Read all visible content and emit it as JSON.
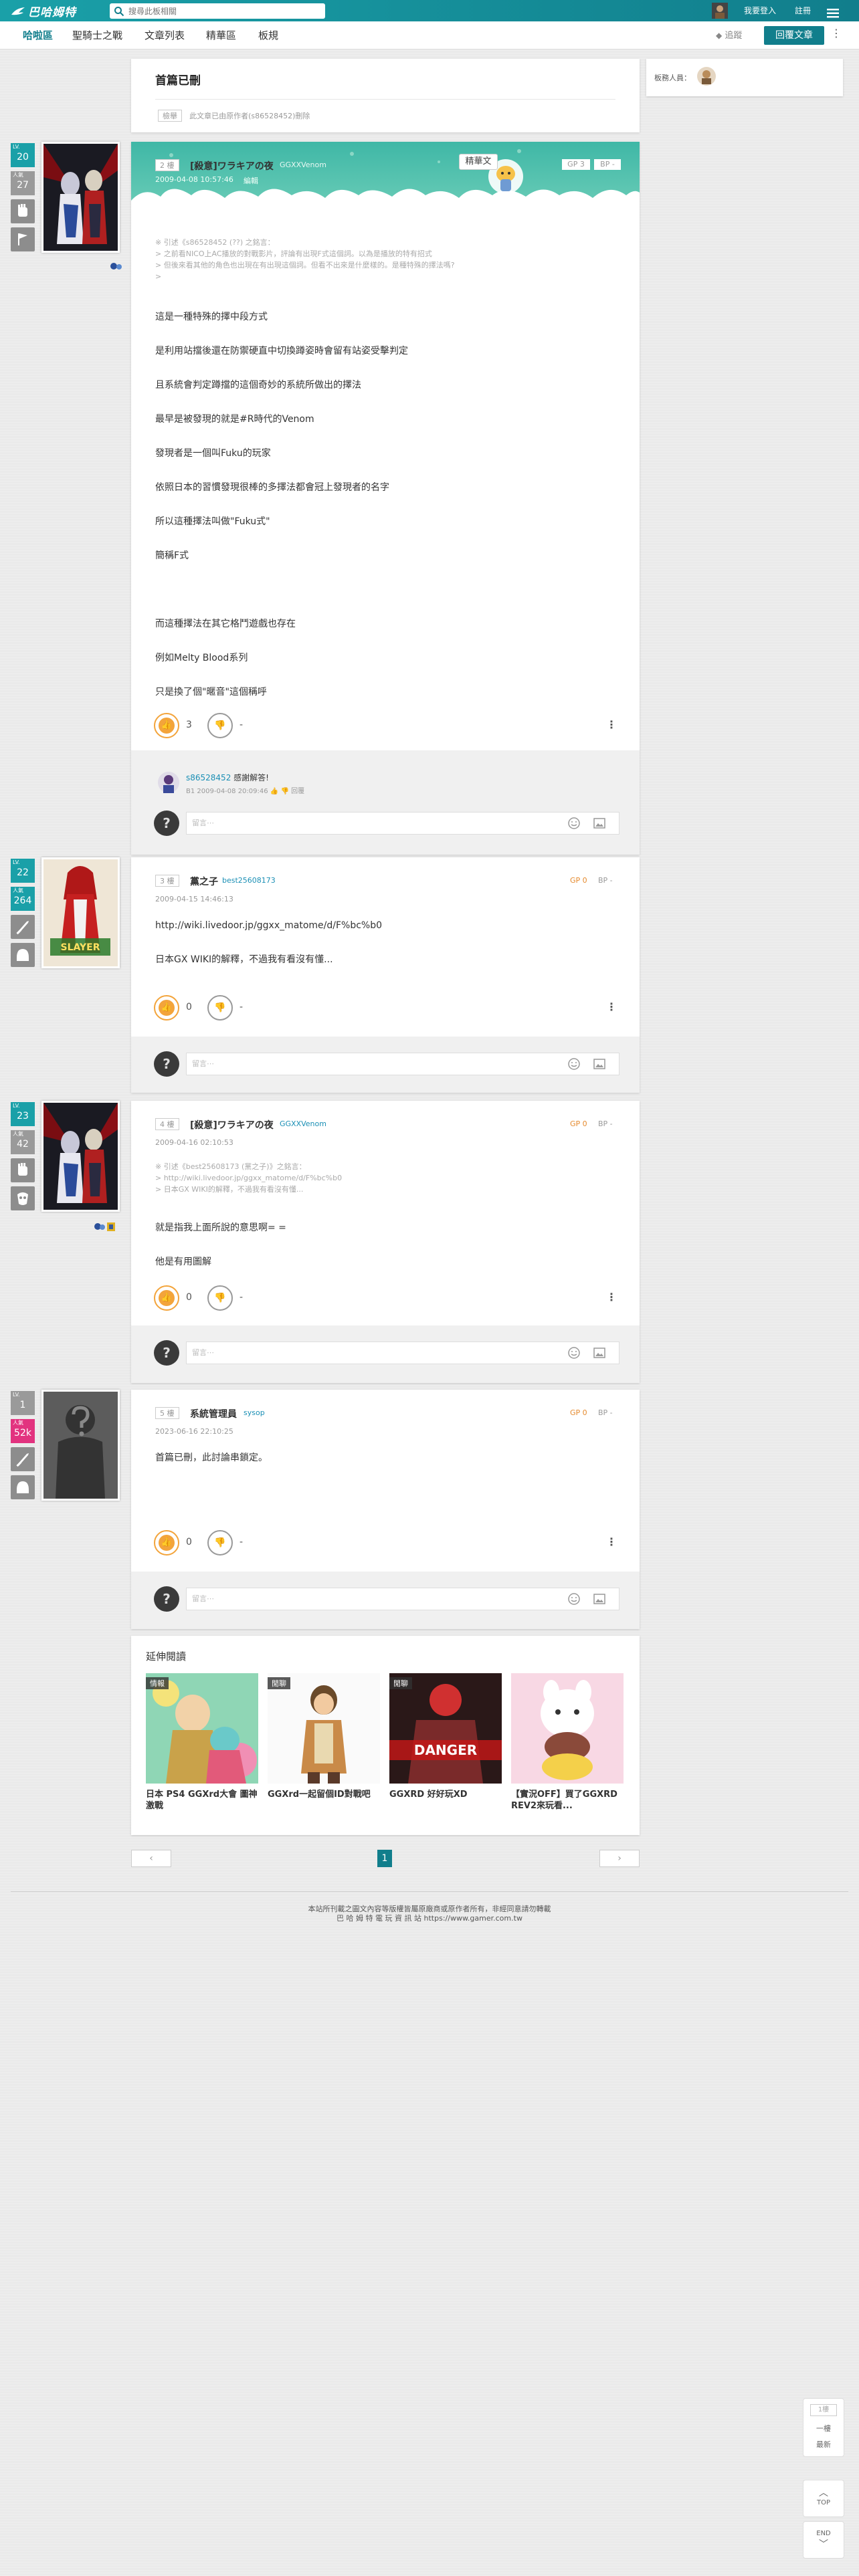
{
  "header": {
    "logo": "巴哈姆特",
    "search_placeholder": "搜尋此板相關",
    "login": "我要登入",
    "register": "註冊"
  },
  "nav": {
    "tabs": [
      "哈啦區",
      "聖騎士之戰",
      "文章列表",
      "精華區",
      "板規"
    ],
    "track": "追蹤",
    "reply": "回覆文章"
  },
  "sidebar": {
    "moderators": "板務人員："
  },
  "title_card": {
    "title": "首篇已刪",
    "tag": "檢舉",
    "note": "此文章已由原作者(s86528452)刪除"
  },
  "posts": [
    {
      "floor": "2 樓",
      "author": "[殺意]ワラキアの夜",
      "uid": "GGXXVenom",
      "time": "2009-04-08 10:57:46",
      "edit": "編輯",
      "gp": "GP 3",
      "bp": "BP -",
      "badge": "精華文",
      "quote": [
        "※ 引述《s86528452 (??) 之銘言：",
        "> 之前看NICO上AC播放的對戰影片，評論有出現F式這個詞。以為是播放的特有招式",
        "> 但後來看其他的角色也出現在有出現這個詞。但看不出來是什麼樣的。是種特殊的擇法嗎?",
        ">"
      ],
      "lines": [
        "這是一種特殊的擇中段方式",
        "是利用站擋後還在防禦硬直中切換蹲姿時會留有站姿受擊判定",
        "且系統會判定蹲擋的這個奇妙的系統所做出的擇法",
        "最早是被發現的就是#R時代的Venom",
        "發現者是一個叫Fuku的玩家",
        "依照日本的習慣發現很棒的多擇法都會冠上發現者的名字",
        "所以這種擇法叫做\"Fuku式\"",
        "簡稱F式",
        "",
        "而這種擇法在其它格鬥遊戲也存在",
        "例如Melty Blood系列",
        "只是換了個\"暱音\"這個稱呼"
      ],
      "likes": "3",
      "dislikes": "-",
      "level": "20",
      "level_label": "LV.",
      "karma": "27",
      "karma_label": "人氣",
      "comment": {
        "user": "s86528452",
        "text": "感謝解答!",
        "meta": "B1  2009-04-08 20:09:46",
        "reply": "回覆"
      },
      "input_placeholder": "留言⋯"
    },
    {
      "floor": "3 樓",
      "author": "黨之子",
      "uid": "best25608173",
      "time": "2009-04-15 14:46:13",
      "gp": "GP 0",
      "bp": "BP -",
      "lines": [
        "http://wiki.livedoor.jp/ggxx_matome/d/F%bc%b0",
        "日本GX WIKI的解釋，不過我有看沒有懂..."
      ],
      "likes": "0",
      "dislikes": "-",
      "level": "22",
      "level_label": "LV.",
      "karma": "264",
      "karma_label": "人氣",
      "input_placeholder": "留言⋯"
    },
    {
      "floor": "4 樓",
      "author": "[殺意]ワラキアの夜",
      "uid": "GGXXVenom",
      "time": "2009-04-16 02:10:53",
      "gp": "GP 0",
      "bp": "BP -",
      "quote": [
        "※ 引述《best25608173 (黨之子)》之銘言：",
        "> http://wiki.livedoor.jp/ggxx_matome/d/F%bc%b0",
        "> 日本GX WIKI的解釋，不過我有看沒有懂..."
      ],
      "lines": [
        "就是指我上面所說的意思啊= =",
        "他是有用圖解"
      ],
      "likes": "0",
      "dislikes": "-",
      "level": "23",
      "level_label": "LV.",
      "karma": "42",
      "karma_label": "人氣",
      "input_placeholder": "留言⋯"
    },
    {
      "floor": "5 樓",
      "author": "系統管理員",
      "uid": "sysop",
      "time": "2023-06-16 22:10:25",
      "gp": "GP 0",
      "bp": "BP -",
      "lines": [
        "首篇已刪，此討論串鎖定。"
      ],
      "likes": "0",
      "dislikes": "-",
      "level": "1",
      "level_label": "LV.",
      "karma": "52k",
      "karma_label": "人氣",
      "input_placeholder": "留言⋯"
    }
  ],
  "related": {
    "title": "延伸閱讀",
    "items": [
      {
        "badge": "情報",
        "title": "日本 PS4 GGXrd大會 圖神激戰"
      },
      {
        "badge": "閒聊",
        "title": "GGXrd一起留個ID對戰吧"
      },
      {
        "badge": "閒聊",
        "title": "GGXRD 好好玩XD"
      },
      {
        "badge": "",
        "title": "【實況OFF】買了GGXRD REV2來玩看..."
      }
    ]
  },
  "pagination": {
    "prev": "‹",
    "current": "1",
    "next": "›"
  },
  "footer": {
    "line1": "本站所刊載之圖文內容等版權皆屬原廠商或原作者所有，非經同意請勿轉載",
    "line2": "巴 哈 姆 特 電 玩 資 訊 站  https://www.gamer.com.tw"
  },
  "float": {
    "first": "一樓",
    "latest": "最新",
    "top": "TOP",
    "end": "END",
    "page_indicator": "1樓"
  },
  "colors": {
    "brand": "#117e8c",
    "accent": "#1aa0a8",
    "like": "#f3a43b",
    "gp": "#e58a2e",
    "uid": "#1a8fb5"
  }
}
